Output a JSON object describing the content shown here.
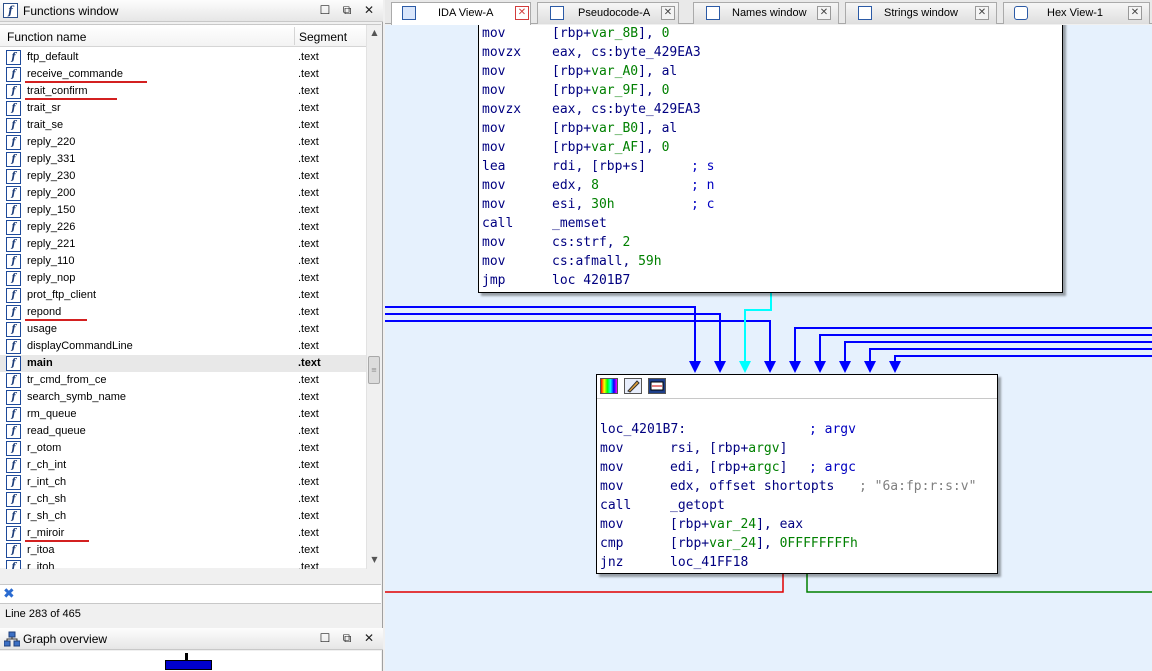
{
  "functions_window": {
    "title": "Functions window",
    "col_name": "Function name",
    "col_segment": "Segment",
    "rows": [
      {
        "name": "ftp_default",
        "segment": ".text"
      },
      {
        "name": "receive_commande",
        "segment": ".text"
      },
      {
        "name": "trait_confirm",
        "segment": ".text"
      },
      {
        "name": "trait_sr",
        "segment": ".text"
      },
      {
        "name": "trait_se",
        "segment": ".text"
      },
      {
        "name": "reply_220",
        "segment": ".text"
      },
      {
        "name": "reply_331",
        "segment": ".text"
      },
      {
        "name": "reply_230",
        "segment": ".text"
      },
      {
        "name": "reply_200",
        "segment": ".text"
      },
      {
        "name": "reply_150",
        "segment": ".text"
      },
      {
        "name": "reply_226",
        "segment": ".text"
      },
      {
        "name": "reply_221",
        "segment": ".text"
      },
      {
        "name": "reply_110",
        "segment": ".text"
      },
      {
        "name": "reply_nop",
        "segment": ".text"
      },
      {
        "name": "prot_ftp_client",
        "segment": ".text"
      },
      {
        "name": "repond",
        "segment": ".text"
      },
      {
        "name": "usage",
        "segment": ".text"
      },
      {
        "name": "displayCommandLine",
        "segment": ".text"
      },
      {
        "name": "main",
        "segment": ".text"
      },
      {
        "name": "tr_cmd_from_ce",
        "segment": ".text"
      },
      {
        "name": "search_symb_name",
        "segment": ".text"
      },
      {
        "name": "rm_queue",
        "segment": ".text"
      },
      {
        "name": "read_queue",
        "segment": ".text"
      },
      {
        "name": "r_otom",
        "segment": ".text"
      },
      {
        "name": "r_ch_int",
        "segment": ".text"
      },
      {
        "name": "r_int_ch",
        "segment": ".text"
      },
      {
        "name": "r_ch_sh",
        "segment": ".text"
      },
      {
        "name": "r_sh_ch",
        "segment": ".text"
      },
      {
        "name": "r_miroir",
        "segment": ".text"
      },
      {
        "name": "r_itoa",
        "segment": ".text"
      },
      {
        "name": "r_itoh",
        "segment": ".text"
      }
    ],
    "selected_row": "main",
    "status": "Line 283 of 465"
  },
  "graph_overview": {
    "title": "Graph overview"
  },
  "tabs": [
    {
      "label": "IDA View-A",
      "icon": "ida-view-icon",
      "active": true
    },
    {
      "label": "Pseudocode-A",
      "icon": "pseudocode-icon",
      "active": false
    },
    {
      "label": "Names window",
      "icon": "names-icon",
      "active": false
    },
    {
      "label": "Strings window",
      "icon": "strings-icon",
      "active": false
    },
    {
      "label": "Hex View-1",
      "icon": "hex-icon",
      "active": false
    }
  ],
  "block1": {
    "lines": [
      {
        "mn": "mov",
        "ops": "[rbp+var_8B], 0"
      },
      {
        "mn": "movzx",
        "ops": "eax, cs:byte_429EA3"
      },
      {
        "mn": "mov",
        "ops": "[rbp+var_A0], al"
      },
      {
        "mn": "mov",
        "ops": "[rbp+var_9F], 0"
      },
      {
        "mn": "movzx",
        "ops": "eax, cs:byte_429EA3"
      },
      {
        "mn": "mov",
        "ops": "[rbp+var_B0], al"
      },
      {
        "mn": "mov",
        "ops": "[rbp+var_AF], 0"
      },
      {
        "mn": "lea",
        "ops": "rdi, [rbp+s]",
        "cmt": "; s"
      },
      {
        "mn": "mov",
        "ops": "edx, 8",
        "cmt": "; n"
      },
      {
        "mn": "mov",
        "ops": "esi, 30h",
        "cmt": "; c"
      },
      {
        "mn": "call",
        "ops": "_memset"
      },
      {
        "mn": "mov",
        "ops": "cs:strf, 2"
      },
      {
        "mn": "mov",
        "ops": "cs:afmall, 59h"
      },
      {
        "mn": "jmp",
        "ops": "loc 4201B7"
      }
    ]
  },
  "block2": {
    "label": "loc_4201B7:",
    "label_cmt": "; argv",
    "lines": [
      {
        "mn": "mov",
        "ops": "rsi, [rbp+argv]"
      },
      {
        "mn": "mov",
        "ops": "edi, [rbp+argc]",
        "cmt": "; argc"
      },
      {
        "mn": "mov",
        "ops": "edx, offset shortopts",
        "cmt": "; \"6a:fp:r:s:v\""
      },
      {
        "mn": "call",
        "ops": "_getopt"
      },
      {
        "mn": "mov",
        "ops": "[rbp+var_24], eax"
      },
      {
        "mn": "cmp",
        "ops": "[rbp+var_24], 0FFFFFFFFh"
      },
      {
        "mn": "jnz",
        "ops": "loc_41FF18"
      }
    ]
  },
  "colors": {
    "edge_blue": "#0000ff",
    "edge_cyan": "#00ffff",
    "edge_red": "#e00000",
    "edge_green": "#008000",
    "graph_bg": "#e6f1fd"
  }
}
